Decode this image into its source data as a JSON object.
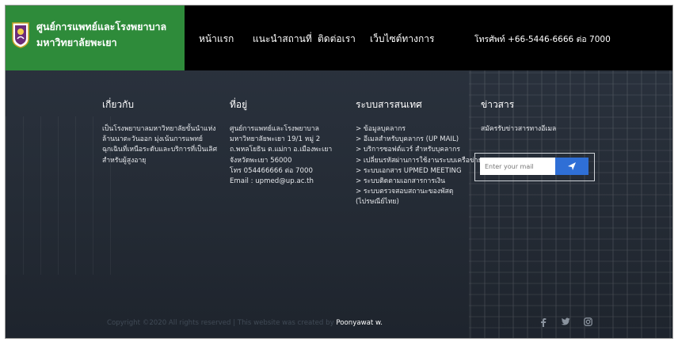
{
  "brand": {
    "line1": "ศูนย์การแพทย์และโรงพยาบาล",
    "line2": "มหาวิทยาลัยพะเยา"
  },
  "nav": {
    "items": [
      {
        "label": "หน้าแรก"
      },
      {
        "label": "แนะนำสถานที่"
      },
      {
        "label": "ติดต่อเรา"
      },
      {
        "label": "เว็บไซต์ทางการ"
      }
    ],
    "phone": "โทรศัพท์ +66-5446-6666 ต่อ 7000"
  },
  "footer": {
    "about": {
      "title": "เกี่ยวกับ",
      "lines": [
        "เป็นโรงพยาบาลมหาวิทยาลัยขั้นนำแห่ง",
        "ล้านนาตะวันออก มุ่งเน้นการแพทย์",
        "ฉุกเฉินที่เหนือระดับและบริการที่เป็นเลิศ",
        "สำหรับผู้สูงอายุ"
      ]
    },
    "address": {
      "title": "ที่อยู่",
      "lines": [
        "ศูนย์การแพทย์และโรงพยาบาล",
        "มหาวิทยาลัยพะเยา 19/1 หมู่ 2",
        "ถ.พหลโยธิน ต.แม่กา อ.เมืองพะเยา",
        "จังหวัดพะเยา 56000",
        "โทร 054466666 ต่อ 7000",
        "Email : upmed@up.ac.th"
      ]
    },
    "systems": {
      "title": "ระบบสารสนเทศ",
      "links": [
        "> ข้อมูลบุคลากร",
        "> อีเมลสำหรับบุคลากร (UP MAIL)",
        "> บริการซอฟต์แวร์ สำหรับบุคลากร",
        "> เปลี่ยนรหัสผ่านการใช้งานระบบเครือข่าย",
        "> ระบบเอกสาร UPMED MEETING",
        "> ระบบติดตามเอกสารการเงิน",
        "> ระบบตรวจสอบสถานะของพัสดุ",
        "(ไปรษณีย์ไทย)"
      ]
    },
    "news": {
      "title": "ข่าวสาร",
      "subtitle": "สมัครรับข่าวสารทางอีเมล",
      "placeholder": "Enter your mail"
    },
    "copyright": {
      "text": "Copyright ©2020 All rights reserved | This website was created by ",
      "author": "Poonyawat w."
    },
    "social_icons": [
      "facebook-icon",
      "twitter-icon",
      "instagram-icon"
    ]
  }
}
